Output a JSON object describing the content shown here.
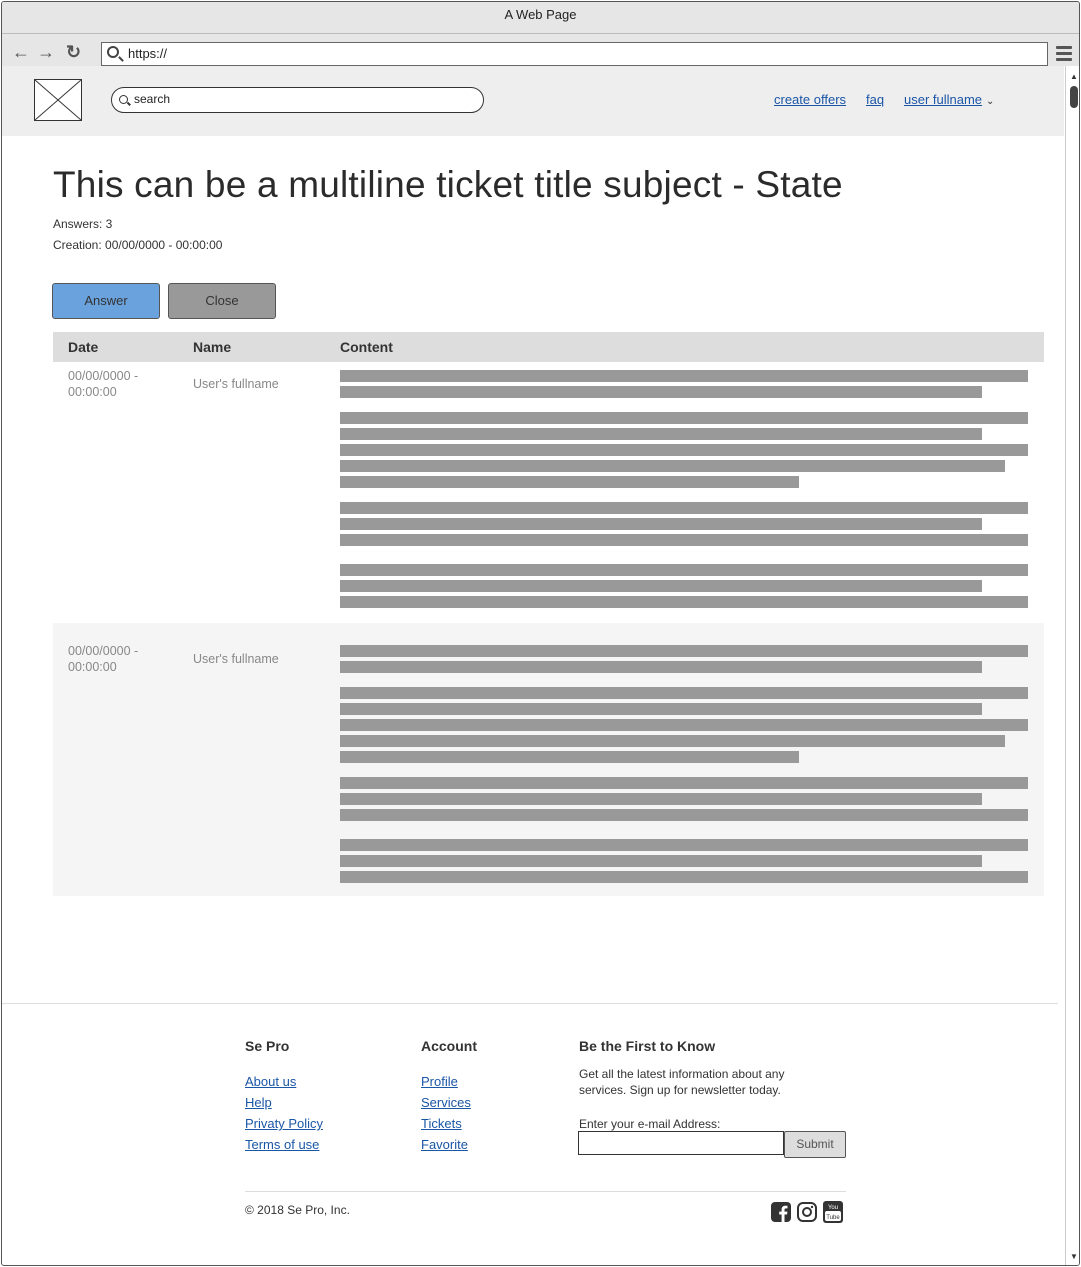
{
  "browser": {
    "window_title": "A Web Page",
    "url": "https://"
  },
  "header": {
    "search_text": "search",
    "links": [
      "create offers",
      "faq",
      "user fullname"
    ]
  },
  "ticket": {
    "title": "This can be a multiline ticket title subject - State",
    "answers": "Answers: 3",
    "creation": "Creation: 00/00/0000 - 00:00:00",
    "answer_button": "Answer",
    "close_button": "Close"
  },
  "table": {
    "columns": [
      "Date",
      "Name",
      "Content"
    ],
    "rows": [
      {
        "date_line1": "00/00/0000 -",
        "date_line2": "00:00:00",
        "name": "User's fullname"
      },
      {
        "date_line1": "00/00/0000 -",
        "date_line2": "00:00:00",
        "name": "User's fullname"
      }
    ]
  },
  "footer": {
    "col1": {
      "title": "Se Pro",
      "links": [
        "About us",
        "Help",
        "Privaty Policy",
        "Terms of use"
      ]
    },
    "col2": {
      "title": "Account",
      "links": [
        "Profile",
        "Services",
        "Tickets",
        "Favorite"
      ]
    },
    "col3": {
      "title": "Be the First to Know",
      "text_line1": "Get all the latest information about any",
      "text_line2": "services. Sign up for newsletter today.",
      "email_label": "Enter your e-mail Address:",
      "submit": "Submit"
    },
    "copyright": "© 2018 Se Pro, Inc.",
    "social_icons": [
      "facebook-icon",
      "instagram-icon",
      "youtube-icon"
    ]
  }
}
